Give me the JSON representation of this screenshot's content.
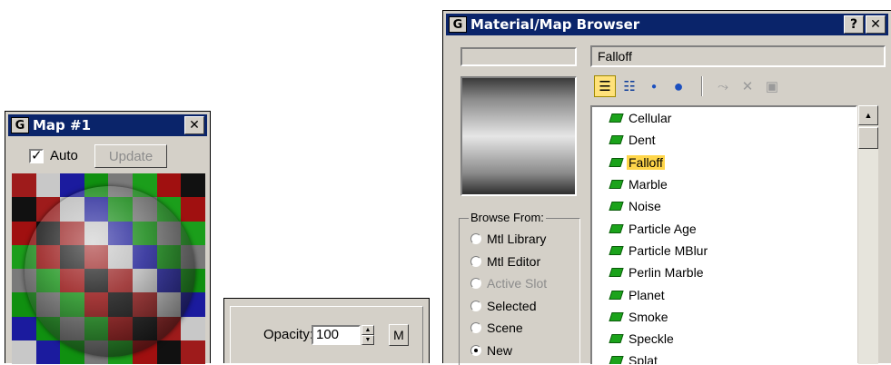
{
  "map_window": {
    "title": "Map #1",
    "close_glyph": "✕",
    "auto_label": "Auto",
    "auto_checked": true,
    "update_label": "Update",
    "checker_colors": [
      "#9e1b1b",
      "#1b9e1b",
      "#1b1b9e",
      "#111111",
      "#7a7a7a",
      "#c8c8c8",
      "#a01010",
      "#109010"
    ]
  },
  "opacity_panel": {
    "label": "Opacity:",
    "value": "100",
    "map_button_label": "M"
  },
  "browser": {
    "title": "Material/Map Browser",
    "help_glyph": "?",
    "close_glyph": "✕",
    "name_value": "Falloff",
    "toolbar_icons": [
      "list-text-icon",
      "list-icons-icon",
      "small-sphere-icon",
      "large-sphere-icon",
      "update-scene-icon",
      "delete-icon",
      "clear-icon"
    ],
    "browse_from": {
      "title": "Browse From:",
      "options": [
        {
          "label": "Mtl Library",
          "checked": false,
          "disabled": false
        },
        {
          "label": "Mtl Editor",
          "checked": false,
          "disabled": false
        },
        {
          "label": "Active Slot",
          "checked": false,
          "disabled": true
        },
        {
          "label": "Selected",
          "checked": false,
          "disabled": false
        },
        {
          "label": "Scene",
          "checked": false,
          "disabled": false
        },
        {
          "label": "New",
          "checked": true,
          "disabled": false
        }
      ]
    },
    "maps": [
      "Cellular",
      "Dent",
      "Falloff",
      "Marble",
      "Noise",
      "Particle Age",
      "Particle MBlur",
      "Perlin Marble",
      "Planet",
      "Smoke",
      "Speckle",
      "Splat"
    ],
    "selected_map": "Falloff"
  }
}
